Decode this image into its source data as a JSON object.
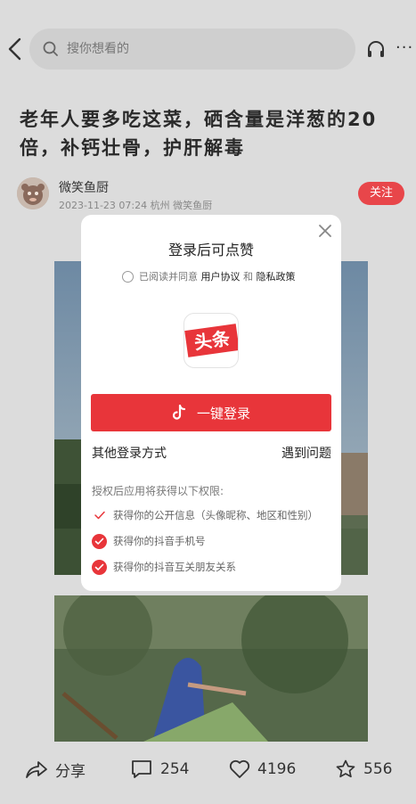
{
  "header": {
    "search_placeholder": "搜你想看的"
  },
  "article": {
    "title": "老年人要多吃这菜，硒含量是洋葱的20倍，补钙壮骨，护肝解毒",
    "author_name": "微笑鱼厨",
    "author_meta": "2023-11-23 07:24 杭州 微笑鱼厨",
    "follow_label": "关注"
  },
  "bottom_bar": {
    "share_label": "分享",
    "comment_count": "254",
    "like_count": "4196",
    "favorite_count": "556"
  },
  "login_modal": {
    "title": "登录后可点赞",
    "agree_prefix": "已阅读并同意",
    "user_agreement": "用户协议",
    "and": "和",
    "privacy_policy": "隐私政策",
    "logo_text": "头条",
    "one_click_login": "一键登录",
    "other_login": "其他登录方式",
    "problem": "遇到问题",
    "permission_title": "授权后应用将获得以下权限:",
    "permissions": [
      "获得你的公开信息（头像昵称、地区和性别）",
      "获得你的抖音手机号",
      "获得你的抖音互关朋友关系"
    ]
  },
  "colors": {
    "accent": "#e8353a",
    "follow": "#e8464a"
  }
}
